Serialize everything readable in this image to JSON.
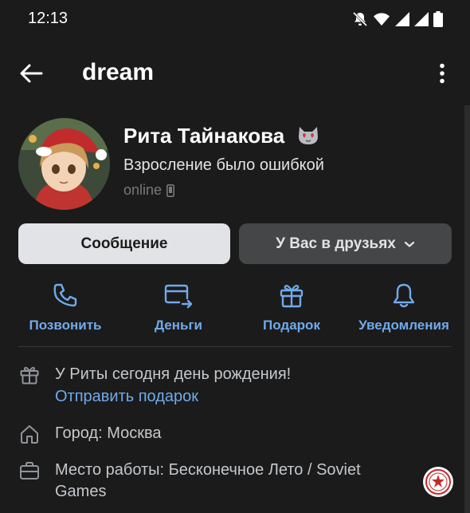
{
  "status_bar": {
    "time": "12:13",
    "icons": [
      "bell-off-icon",
      "wifi-icon",
      "signal-icon",
      "signal-icon",
      "battery-icon"
    ]
  },
  "header": {
    "title": "dream"
  },
  "profile": {
    "name": "Рита Тайнакова",
    "status": "Взросление было ошибкой",
    "online": "online"
  },
  "buttons": {
    "message": "Сообщение",
    "friends": "У Вас в друзьях"
  },
  "actions": [
    {
      "label": "Позвонить",
      "icon": "phone-icon"
    },
    {
      "label": "Деньги",
      "icon": "money-transfer-icon"
    },
    {
      "label": "Подарок",
      "icon": "gift-icon"
    },
    {
      "label": "Уведомления",
      "icon": "bell-icon"
    }
  ],
  "info": {
    "birthday": "У Риты сегодня день рождения!",
    "send_gift": "Отправить подарок",
    "city": "Город: Москва",
    "work_line1": "Место работы: Бесконечное Лето / Soviet",
    "work_line2": "Games"
  },
  "colors": {
    "background": "#1b1b1b",
    "accent": "#71aaeb",
    "text_primary": "#ffffff",
    "text_secondary": "#76787a",
    "button_light": "#e1e3e6",
    "button_dark": "#454647"
  }
}
